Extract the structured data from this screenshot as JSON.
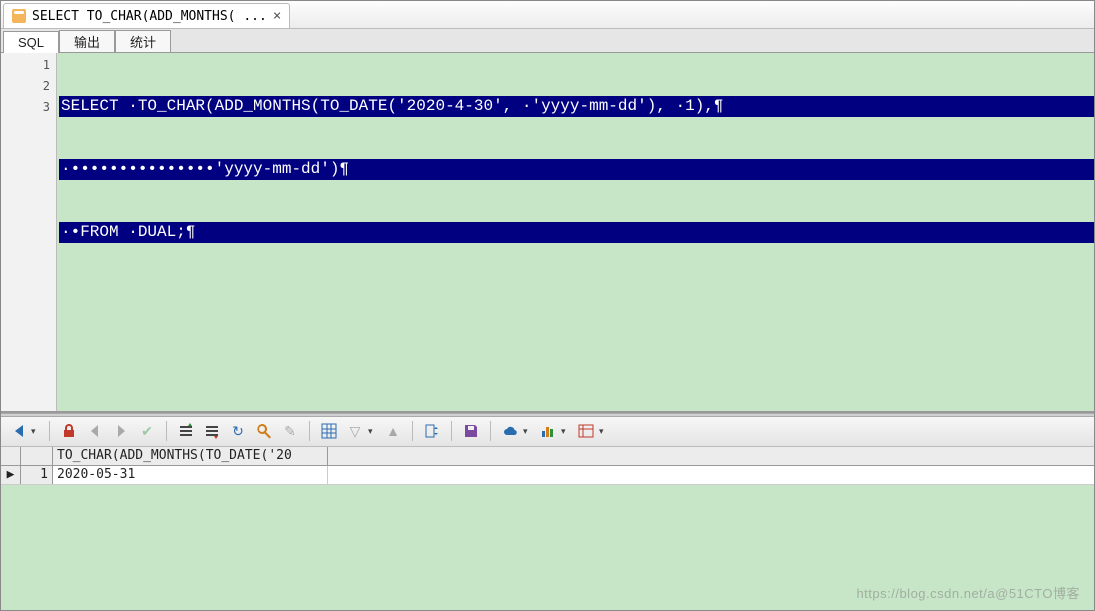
{
  "window": {
    "tab_title": "SELECT TO_CHAR(ADD_MONTHS( ..."
  },
  "subtabs": {
    "sql": "SQL",
    "output": "输出",
    "stats": "统计"
  },
  "editor": {
    "line_numbers": [
      "1",
      "2",
      "3"
    ],
    "lines": [
      "SELECT ·TO_CHAR(ADD_MONTHS(TO_DATE('2020-4-30', ·'yyyy-mm-dd'), ·1),¶",
      "·•••••••••••••••'yyyy-mm-dd')¶",
      "·•FROM ·DUAL;¶"
    ]
  },
  "toolbar": {
    "nav_first": "nav-first",
    "lock": "lock",
    "nav_prev": "nav-prev",
    "nav_next": "nav-next",
    "check": "check",
    "insert": "insert",
    "delete": "delete",
    "refresh": "refresh",
    "find": "find",
    "edit": "edit",
    "grid": "grid",
    "dropdown": "dropdown",
    "collapse": "collapse",
    "export": "export",
    "save": "save",
    "cloud": "cloud",
    "chart": "chart",
    "table-menu": "table-menu"
  },
  "results": {
    "header_col1": "TO_CHAR(ADD_MONTHS(TO_DATE('20",
    "rows": [
      {
        "n": "1",
        "val": "2020-05-31"
      }
    ]
  },
  "watermark": "https://blog.csdn.net/a@51CTO博客"
}
